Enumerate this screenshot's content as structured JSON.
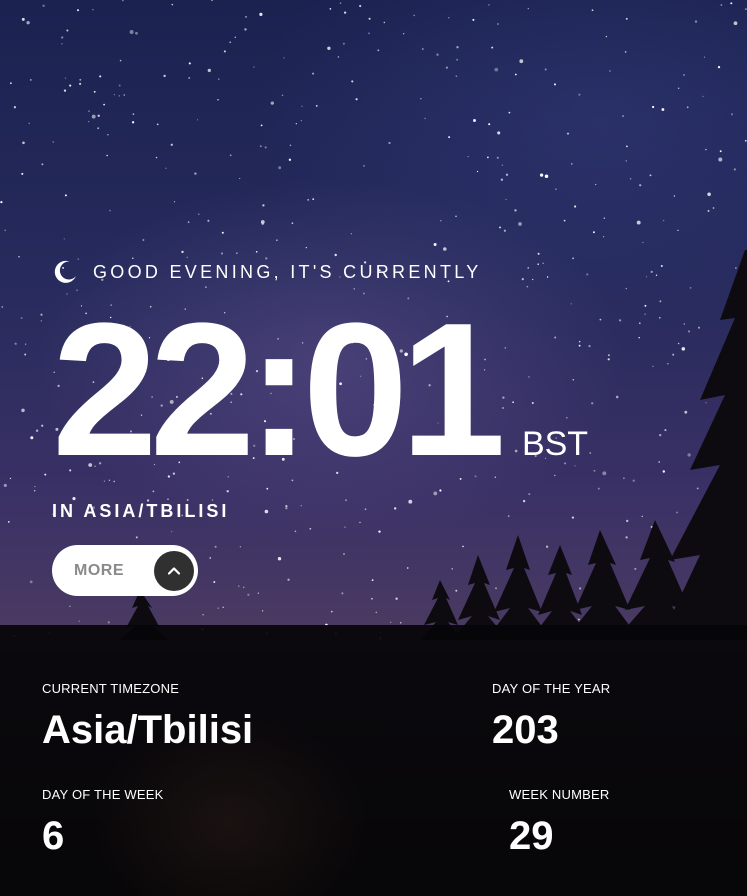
{
  "greeting": {
    "icon": "moon-icon",
    "text": "GOOD EVENING, IT'S CURRENTLY"
  },
  "clock": {
    "time": "22:01",
    "abbreviation": "BST",
    "location": "IN ASIA/TBILISI"
  },
  "more_button": {
    "label": "MORE",
    "icon": "chevron-up-icon"
  },
  "details": {
    "current_timezone": {
      "label": "CURRENT TIMEZONE",
      "value": "Asia/Tbilisi"
    },
    "day_of_year": {
      "label": "DAY OF THE YEAR",
      "value": "203"
    },
    "day_of_week": {
      "label": "DAY OF THE WEEK",
      "value": "6"
    },
    "week_number": {
      "label": "WEEK NUMBER",
      "value": "29"
    }
  },
  "colors": {
    "text": "#ffffff",
    "button_bg": "#ffffff",
    "button_label": "#8a8a8a",
    "chevron_bg": "#303030",
    "panel_bg": "#060508"
  }
}
